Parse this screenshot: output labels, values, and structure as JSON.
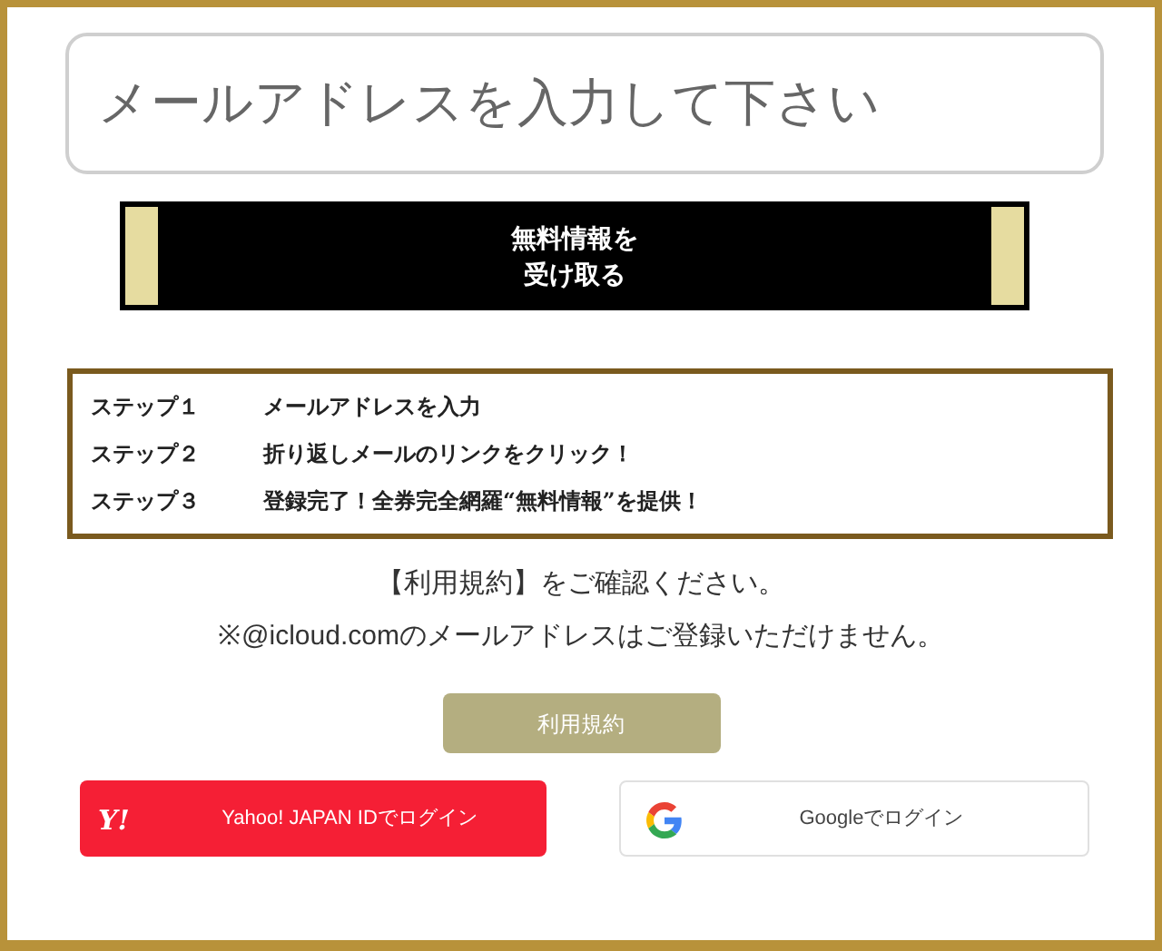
{
  "email_field": {
    "placeholder": "メールアドレスを入力して下さい"
  },
  "submit_button": {
    "lines": [
      "無料情報を",
      "受け取る"
    ]
  },
  "steps": [
    {
      "step": "ステップ１",
      "text": "メールアドレスを入力"
    },
    {
      "step": "ステップ２",
      "text": "折り返しメールのリンクをクリック！"
    },
    {
      "step": "ステップ３",
      "text": "登録完了！全券完全網羅“無料情報”を提供！"
    }
  ],
  "notes": [
    "【利用規約】をご確認ください。",
    "※@icloud.comのメールアドレスはご登録いただけません。"
  ],
  "terms_button": {
    "label": "利用規約"
  },
  "login_buttons": [
    {
      "kind": "yahoo",
      "logo": "Y!",
      "label": "Yahoo! JAPAN IDでログイン"
    },
    {
      "kind": "google",
      "label": "Googleでログイン"
    }
  ]
}
